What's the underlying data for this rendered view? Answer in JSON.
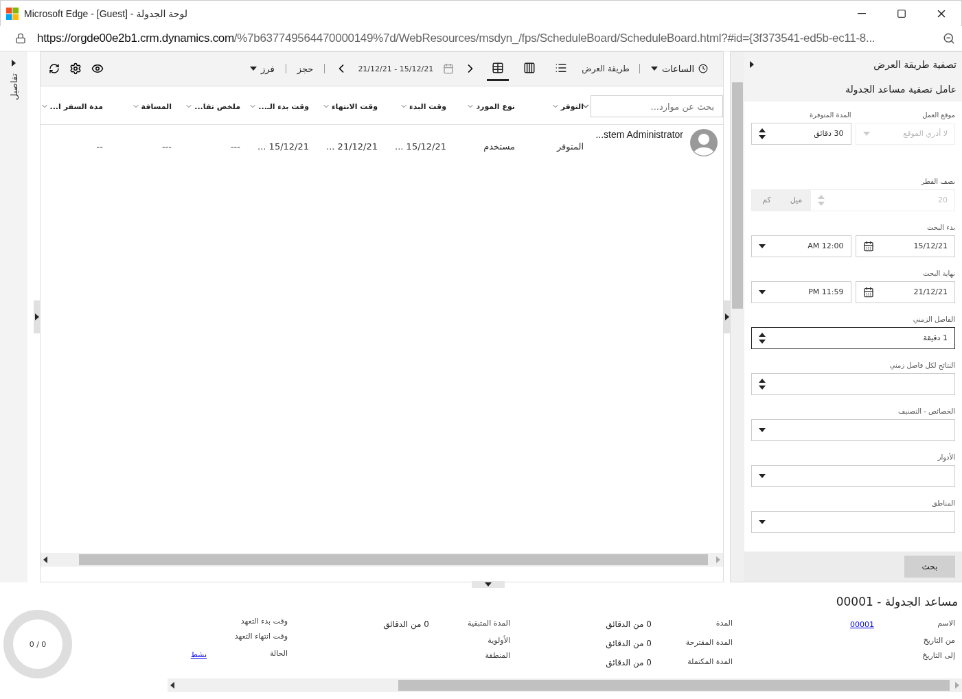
{
  "window": {
    "title": "Microsoft Edge - [Guest] - لوحة الجدولة",
    "url_host": "https://orgde00e2b1.crm.dynamics.com",
    "url_path": "/%7b637749564470000149%7d/WebResources/msdyn_/fps/ScheduleBoard/ScheduleBoard.html?#id={3f373541-ed5b-ec11-8..."
  },
  "side_tab": {
    "label": "تفاصيل"
  },
  "toolbar": {
    "view_select": "الساعات",
    "view_mode_label": "طريقة العرض",
    "view_buttons": [
      {
        "kind": "list",
        "selected": false
      },
      {
        "kind": "columns",
        "selected": false
      },
      {
        "kind": "grid",
        "selected": true
      }
    ],
    "date_range": "21/12/21 - 15/12/21",
    "book": "حجز",
    "sort": "فرز"
  },
  "search": {
    "placeholder": "بحث عن موارد..."
  },
  "columns": [
    "التوفر",
    "نوع المورد",
    "وقت البدء",
    "وقت الانتهاء",
    "وقت بدء الـ...",
    "ملخص تفا...",
    "المسافة",
    "مدة السفر ا..."
  ],
  "rows": [
    {
      "name": "...stem Administrator",
      "cells": [
        "المتوفر",
        "مستخدم",
        "15/12/21 ...",
        "21/12/21 ...",
        "15/12/21 ...",
        "---",
        "---",
        "--"
      ]
    }
  ],
  "filter": {
    "title": "تصفية طريقة العرض",
    "subtitle": "عامل تصفية مساعد الجدولة",
    "rows": [
      {
        "fields": [
          {
            "label": "موقع العمل",
            "kind": "dropdown",
            "placeholder": "لا أدري الموقع",
            "disabled": true,
            "focused": false
          },
          {
            "label": "المدة المتوفرة",
            "kind": "spinner",
            "value": "30 دقائق",
            "disabled": false,
            "focused": false
          }
        ]
      },
      {
        "label": "نصف القطر",
        "fields": [
          {
            "kind": "radius",
            "value": "20",
            "units": [
              "ميل",
              "كم"
            ],
            "disabled": true,
            "focused": false
          }
        ]
      },
      {
        "label": "بدء البحث",
        "fields": [
          {
            "kind": "date",
            "value": "15/12/21",
            "disabled": false,
            "focused": false
          },
          {
            "kind": "time",
            "value": "AM 12:00",
            "disabled": false,
            "focused": false
          }
        ]
      },
      {
        "label": "نهاية البحث",
        "fields": [
          {
            "kind": "date",
            "value": "21/12/21",
            "disabled": false,
            "focused": false
          },
          {
            "kind": "time",
            "value": "PM 11:59",
            "disabled": false,
            "focused": false
          }
        ]
      },
      {
        "label": "الفاصل الزمني",
        "fields": [
          {
            "kind": "spinner",
            "value": "1 دقيقة",
            "disabled": false,
            "focused": true
          }
        ]
      },
      {
        "label": "النتائج لكل فاصل زمني",
        "fields": [
          {
            "kind": "spinner",
            "disabled": false,
            "focused": false
          }
        ]
      },
      {
        "label": "الخصائص - التصنيف",
        "fields": [
          {
            "kind": "dropdown",
            "disabled": false,
            "focused": false
          }
        ]
      },
      {
        "label": "الأدوار",
        "fields": [
          {
            "kind": "dropdown",
            "disabled": false,
            "focused": false
          }
        ]
      },
      {
        "label": "المناطق",
        "fields": [
          {
            "kind": "dropdown",
            "disabled": false,
            "focused": false
          }
        ]
      }
    ],
    "search_button": "بحث"
  },
  "details": {
    "title": "مساعد الجدولة - 00001",
    "progress": "0 / 0",
    "groups": [
      [
        {
          "label": "الاسم",
          "value": "00001",
          "link": true
        },
        {
          "label": "من التاريخ"
        },
        {
          "label": "إلى التاريخ"
        }
      ],
      [
        {
          "label": "المدة",
          "value": "0 من الدقائق",
          "link": false
        },
        {
          "label": "المدة المقترحة",
          "value": "0 من الدقائق",
          "link": false
        },
        {
          "label": "المدة المكتملة",
          "value": "0 من الدقائق",
          "link": false
        }
      ],
      [
        {
          "label": "المدة المتبقية",
          "value": "0 من الدقائق",
          "link": false
        },
        {
          "label": "الأولوية"
        },
        {
          "label": "المنطقة"
        }
      ],
      [
        {
          "label": "وقت بدء التعهد"
        },
        {
          "label": "وقت انتهاء التعهد"
        },
        {
          "label": "الحالة",
          "value": "نشط",
          "link": true
        }
      ]
    ]
  }
}
